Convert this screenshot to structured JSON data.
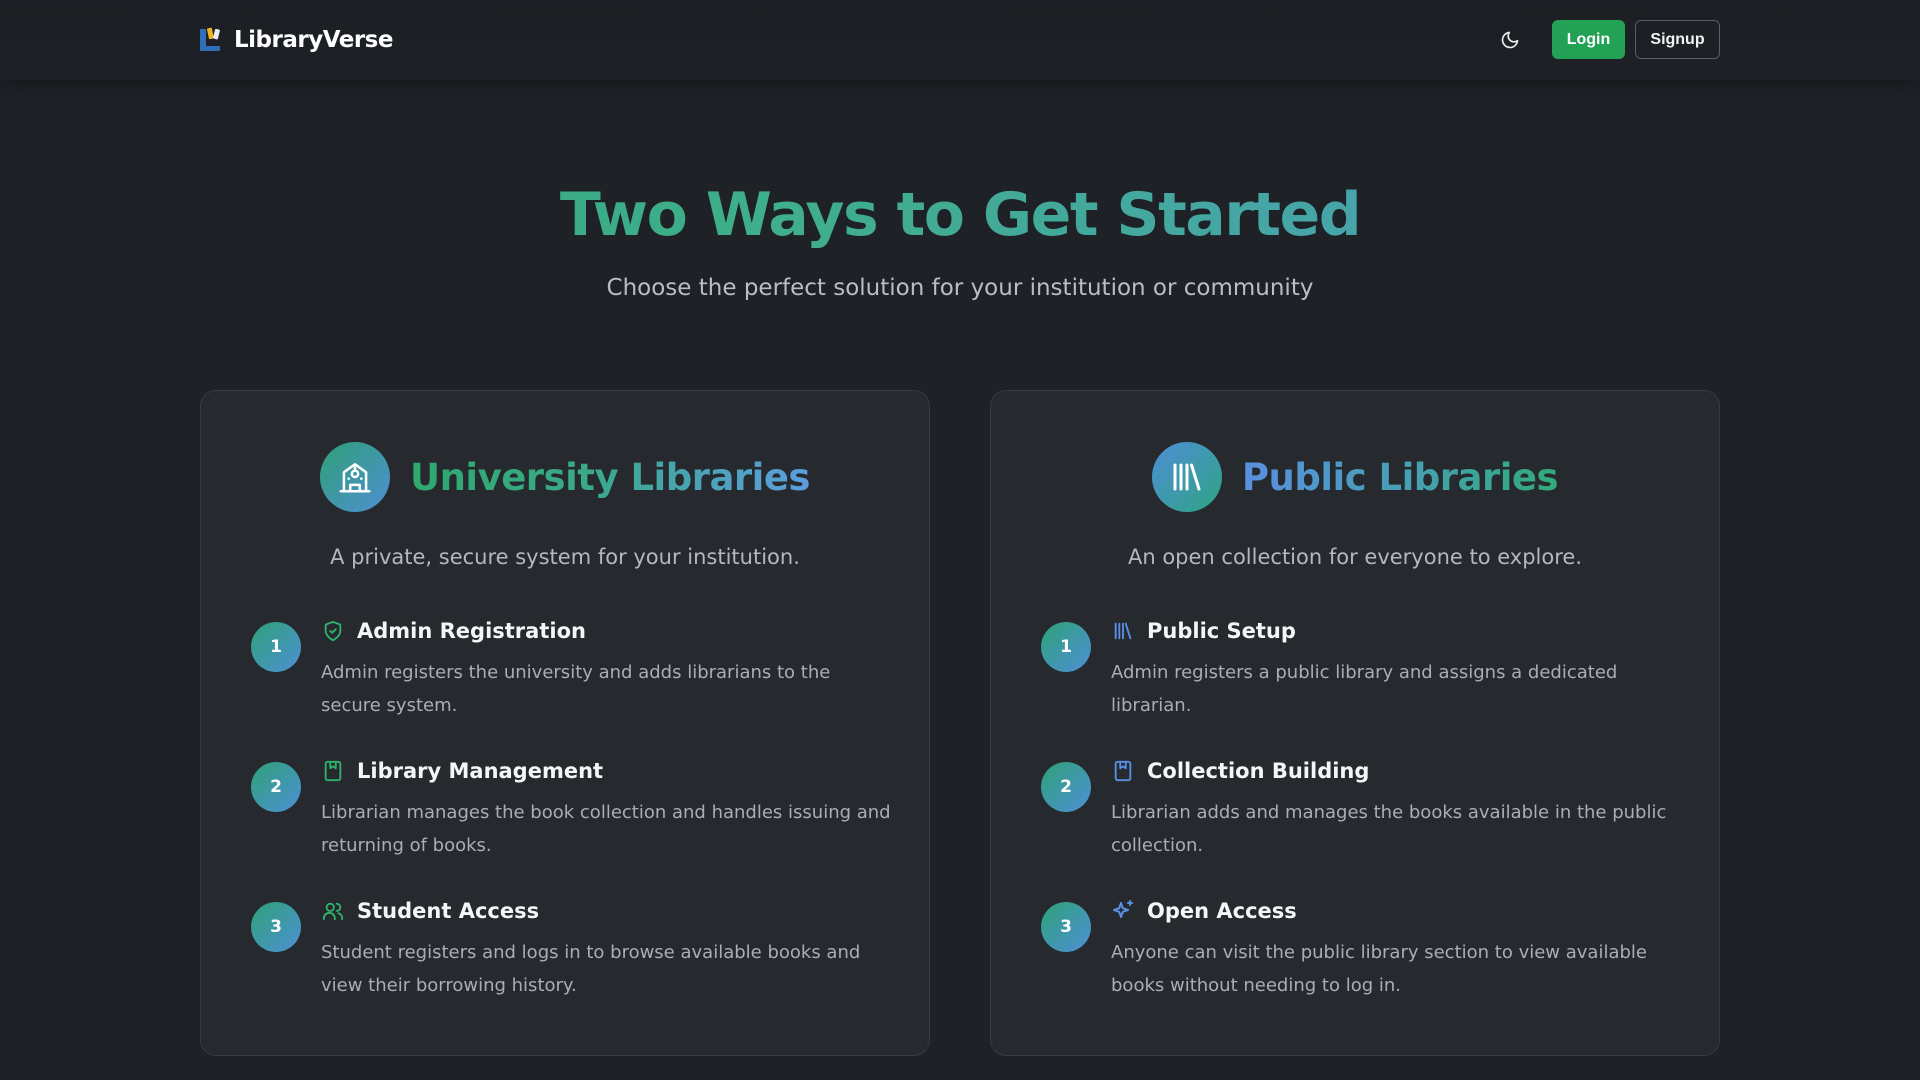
{
  "nav": {
    "brand": "LibraryVerse",
    "login_label": "Login",
    "signup_label": "Signup",
    "theme_icon": "moon-icon"
  },
  "hero": {
    "title": "Two Ways to Get Started",
    "subtitle": "Choose the perfect solution for your institution or community"
  },
  "university": {
    "title": "University Libraries",
    "description": "A private, secure system for your institution.",
    "icon": "university-building-icon",
    "steps": [
      {
        "num": "1",
        "icon": "shield-check-icon",
        "title": "Admin Registration",
        "text": "Admin registers the university and adds librarians to the secure system."
      },
      {
        "num": "2",
        "icon": "bookmark-book-icon",
        "title": "Library Management",
        "text": "Librarian manages the book collection and handles issuing and returning of books."
      },
      {
        "num": "3",
        "icon": "users-icon",
        "title": "Student Access",
        "text": "Student registers and logs in to browse available books and view their borrowing history."
      }
    ]
  },
  "public": {
    "title": "Public Libraries",
    "description": "An open collection for everyone to explore.",
    "icon": "library-books-icon",
    "steps": [
      {
        "num": "1",
        "icon": "library-books-icon",
        "title": "Public Setup",
        "text": "Admin registers a public library and assigns a dedicated librarian."
      },
      {
        "num": "2",
        "icon": "bookmark-book-icon",
        "title": "Collection Building",
        "text": "Librarian adds and manages the books available in the public collection."
      },
      {
        "num": "3",
        "icon": "sparkles-icon",
        "title": "Open Access",
        "text": "Anyone can visit the public library section to view available books without needing to log in."
      }
    ]
  },
  "colors": {
    "accent_green": "#23a155",
    "gradient_green": "#2fa77c",
    "gradient_blue": "#4d9bc8",
    "background": "#1e2126",
    "card": "#262a2f"
  }
}
